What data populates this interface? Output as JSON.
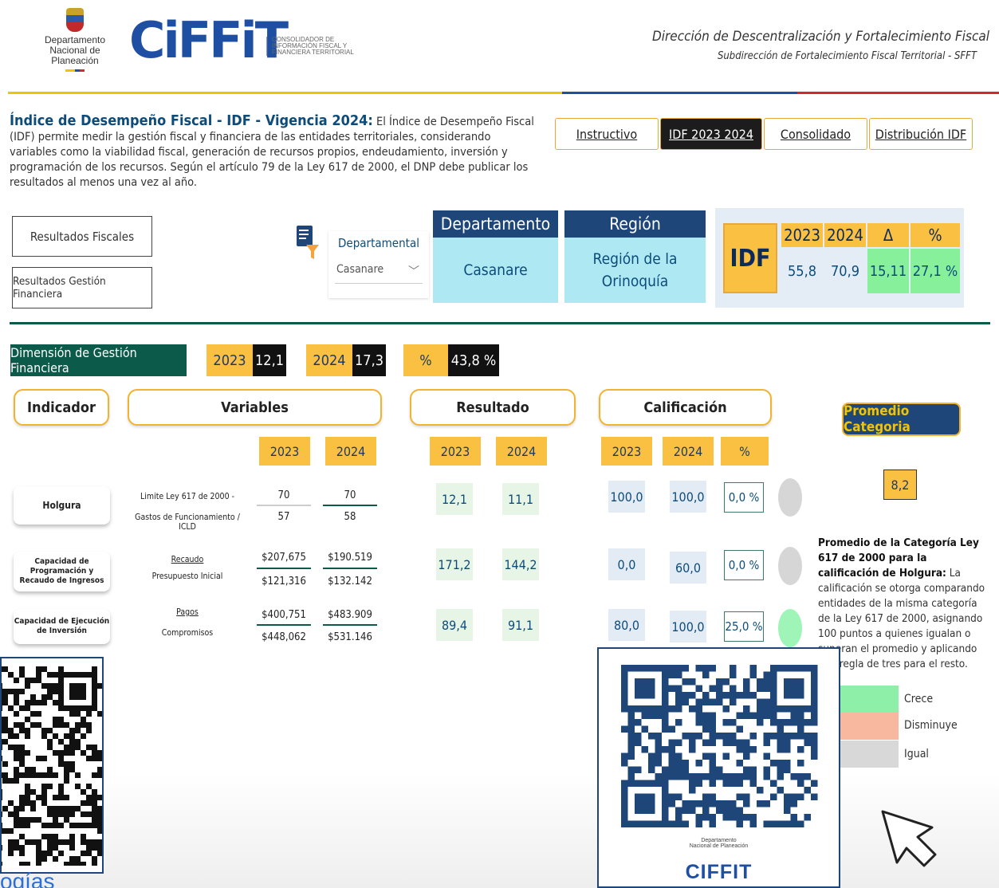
{
  "header": {
    "dnp_line1": "Departamento",
    "dnp_line2": "Nacional de Planeación",
    "logo_text": "CiFFiT",
    "logo_sub": "CONSOLIDADOR DE INFORMACIÓN FISCAL Y FINANCIERA TERRITORIAL",
    "title": "Dirección de Descentralización y Fortalecimiento Fiscal",
    "subtitle": "Subdirección de Fortalecimiento Fiscal Territorial - SFFT"
  },
  "intro": {
    "title": "Índice de Desempeño Fiscal - IDF - Vigencia 2024:",
    "text": " El Índice de Desempeño Fiscal (IDF) permite medir la gestión fiscal y financiera de las entidades territoriales, considerando variables como la viabilidad fiscal, generación de recursos propios, endeudamiento, inversión y programación de los recursos. Según el artículo 79 de la Ley 617 de 2000, el DNP debe publicar los resultados al menos una vez al año."
  },
  "tabs": [
    "Instructivo",
    "IDF 2023 2024",
    "Consolidado",
    "Distribución IDF"
  ],
  "left_buttons": [
    "Resultados Fiscales",
    "Resultados Gestión Financiera"
  ],
  "filter": {
    "label": "Departamental",
    "value": "Casanare",
    "chevron": "﹀"
  },
  "departamento": {
    "header": "Departamento",
    "value": "Casanare"
  },
  "region": {
    "header": "Región",
    "value_line1": "Región de la",
    "value_line2": "Orinoquía"
  },
  "idf": {
    "label": "IDF",
    "headers": [
      "2023",
      "2024",
      "Δ",
      "%"
    ],
    "values": [
      "55,8",
      "70,9",
      "15,11",
      "27,1 %"
    ],
    "colors": {
      "header": "#fac041",
      "delta_bg": "#86f09a",
      "base_bg": "#e4edf5"
    }
  },
  "dimension": {
    "label": "Dimensión de Gestión Financiera",
    "y1_label": "2023",
    "y1_value": "12,1",
    "y2_label": "2024",
    "y2_value": "17,3",
    "pct_label": "%",
    "pct_value": "43,8 %"
  },
  "sections": {
    "indicador": "Indicador",
    "variables": "Variables",
    "resultado": "Resultado",
    "calificacion": "Calificación"
  },
  "year_heads": {
    "y1": "2023",
    "y2": "2024",
    "pct": "%"
  },
  "promedio": {
    "button": "Promedio Categoria",
    "value": "8,2",
    "bold_text": "Promedio de la Categoría Ley 617 de 2000 para la calificación de Holgura:",
    "text": " La calificación se otorga comparando entidades de la misma categoría de la Ley 617 de 2000, asignando 100 puntos a quienes igualan o superan el promedio y aplicando una regla de tres para el resto."
  },
  "rows": [
    {
      "indicador": "Holgura",
      "var_top": "Limite Ley 617 de 2000 -",
      "var_bottom": "Gastos de Funcionamiento / ICLD",
      "num_2023": "70",
      "den_2023": "57",
      "num_2024": "70",
      "den_2024": "58",
      "res_2023": "12,1",
      "res_2024": "11,1",
      "cal_2023": "100,0",
      "cal_2024": "100,0",
      "pct": "0,0 %",
      "trend": "Igual"
    },
    {
      "indicador": "Capacidad de Programación y Recaudo de Ingresos",
      "var_top": "Recaudo",
      "var_bottom": "Presupuesto Inicial",
      "num_2023": "$207,675",
      "den_2023": "$121,316",
      "num_2024": "$190.519",
      "den_2024": "$132.142",
      "res_2023": "171,2",
      "res_2024": "144,2",
      "cal_2023": "0,0",
      "cal_2024": "60,0",
      "pct": "0,0 %",
      "trend": "Igual"
    },
    {
      "indicador": "Capacidad de Ejecución de Inversión",
      "var_top": "Pagos",
      "var_bottom": "Compromisos",
      "num_2023": "$400,751",
      "den_2023": "$448,062",
      "num_2024": "$483.909",
      "den_2024": "$531.146",
      "res_2023": "89,4",
      "res_2024": "91,1",
      "cal_2023": "80,0",
      "cal_2024": "100,0",
      "pct": "25,0 %",
      "trend": "Crece"
    }
  ],
  "legend": [
    {
      "label": "Crece",
      "color": "#8ef0a8"
    },
    {
      "label": "Disminuye",
      "color": "#f8b8a0"
    },
    {
      "label": "Igual",
      "color": "#d8d8d8"
    }
  ],
  "qr_overlay": {
    "dnp_line1": "Departamento",
    "dnp_line2": "Nacional de Planeación",
    "brand": "CIFFIT"
  },
  "bottom_link": "ogías"
}
